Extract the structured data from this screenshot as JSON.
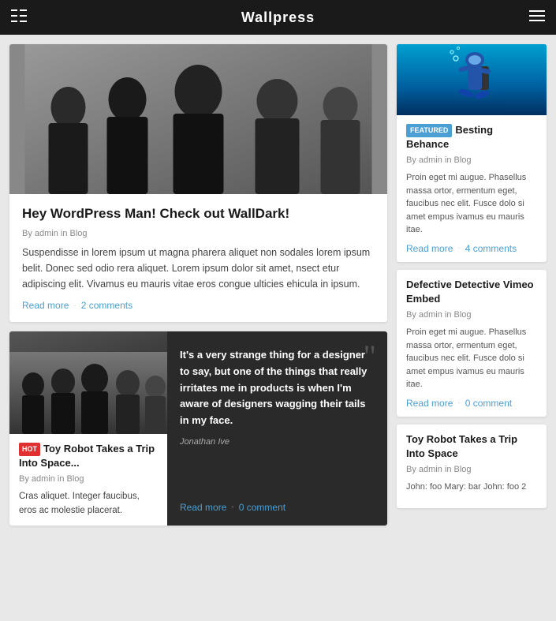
{
  "header": {
    "title": "Wallpress",
    "left_icon": "sidebar-icon",
    "right_icon": "menu-icon"
  },
  "left_main_card": {
    "title": "Hey WordPress Man! Check out WallDark!",
    "meta": "By admin in Blog",
    "excerpt": "Suspendisse in lorem ipsum ut magna pharera aliquet non sodales lorem ipsum belit. Donec sed odio rera aliquet. Lorem ipsum dolor sit amet, nsect etur adipiscing elit. Vivamus eu mauris vitae eros congue ulticies ehicula in ipsum.",
    "read_more": "Read more",
    "comments": "2 comments"
  },
  "bottom_video_card": {
    "badge": "HOT",
    "title": "Toy Robot Takes a Trip Into Space...",
    "meta": "By admin in Blog",
    "excerpt": "Cras aliquet. Integer faucibus, eros ac molestie placerat."
  },
  "bottom_quote_card": {
    "text": "It's a very strange thing for a designer to say, but one of the things that really irritates me in products is when I'm aware of designers wagging their tails in my face.",
    "author": "Jonathan Ive",
    "read_more": "Read more",
    "dot": "·",
    "comments": "0 comment"
  },
  "right_col": {
    "card1": {
      "badge": "FEATURED",
      "title": "Besting Behance",
      "meta": "By admin in Blog",
      "excerpt": "Proin eget mi augue. Phasellus massa ortor, ermentum eget, faucibus nec elit. Fusce dolo si amet empus ivamus eu mauris itae.",
      "read_more": "Read more",
      "dot": "·",
      "comments": "4 comments"
    },
    "card2": {
      "title": "Defective Detective Vimeo Embed",
      "meta": "By admin in Blog",
      "excerpt": "Proin eget mi augue. Phasellus massa ortor, ermentum eget, faucibus nec elit. Fusce dolo si amet empus ivamus eu mauris itae.",
      "read_more": "Read more",
      "dot": "·",
      "comments": "0 comment"
    },
    "card3": {
      "title": "Toy Robot Takes a Trip Into Space",
      "meta": "By admin in Blog",
      "excerpt": "John: foo Mary: bar John: foo\n2"
    }
  },
  "icons": {
    "sidebar": "▤",
    "menu": "≡",
    "quote_mark": "❞",
    "play": "▶"
  }
}
